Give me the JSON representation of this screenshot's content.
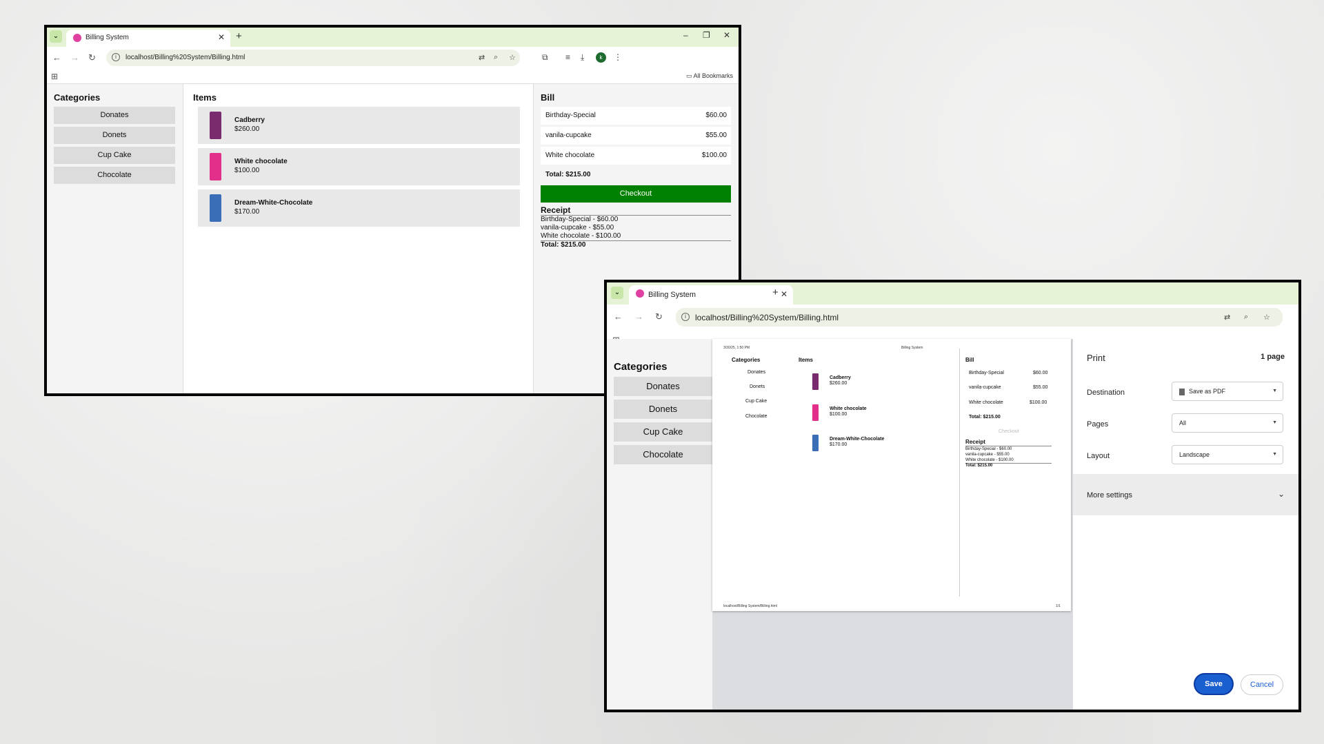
{
  "browser": {
    "tab_title": "Billing System",
    "url": "localhost/Billing%20System/Billing.html",
    "all_bookmarks": "All Bookmarks",
    "profile_initial": "k"
  },
  "app": {
    "categories_heading": "Categories",
    "categories": [
      "Donates",
      "Donets",
      "Cup Cake",
      "Chocolate"
    ],
    "items_heading": "Items",
    "items": [
      {
        "name": "Cadberry",
        "price": "$260.00",
        "color": "#7a2b6e"
      },
      {
        "name": "White chocolate",
        "price": "$100.00",
        "color": "#e2308a"
      },
      {
        "name": "Dream-White-Chocolate",
        "price": "$170.00",
        "color": "#3a6fb8"
      }
    ],
    "bill_heading": "Bill",
    "bill_rows": [
      {
        "name": "Birthday-Special",
        "price": "$60.00"
      },
      {
        "name": "vanila-cupcake",
        "price": "$55.00"
      },
      {
        "name": "White chocolate",
        "price": "$100.00"
      }
    ],
    "total": "Total: $215.00",
    "checkout_label": "Checkout",
    "receipt_heading": "Receipt",
    "receipt_lines": [
      "Birthday-Special - $60.00",
      "vanila-cupcake - $55.00",
      "White chocolate - $100.00"
    ],
    "receipt_total": "Total: $215.00"
  },
  "print_preview": {
    "header_date": "3/30/25, 1:50 PM",
    "header_title": "Billing System",
    "footer_url": "localhost/Billing System/Billing.html",
    "footer_page": "1/1"
  },
  "print_dialog": {
    "title": "Print",
    "page_count": "1 page",
    "destination_label": "Destination",
    "destination_value": "Save as PDF",
    "pages_label": "Pages",
    "pages_value": "All",
    "layout_label": "Layout",
    "layout_value": "Landscape",
    "more_settings": "More settings",
    "save_label": "Save",
    "cancel_label": "Cancel"
  },
  "colors": {
    "checkout_green": "#008000",
    "save_blue": "#1a5fd0",
    "tabstrip": "#e6f2d5"
  }
}
